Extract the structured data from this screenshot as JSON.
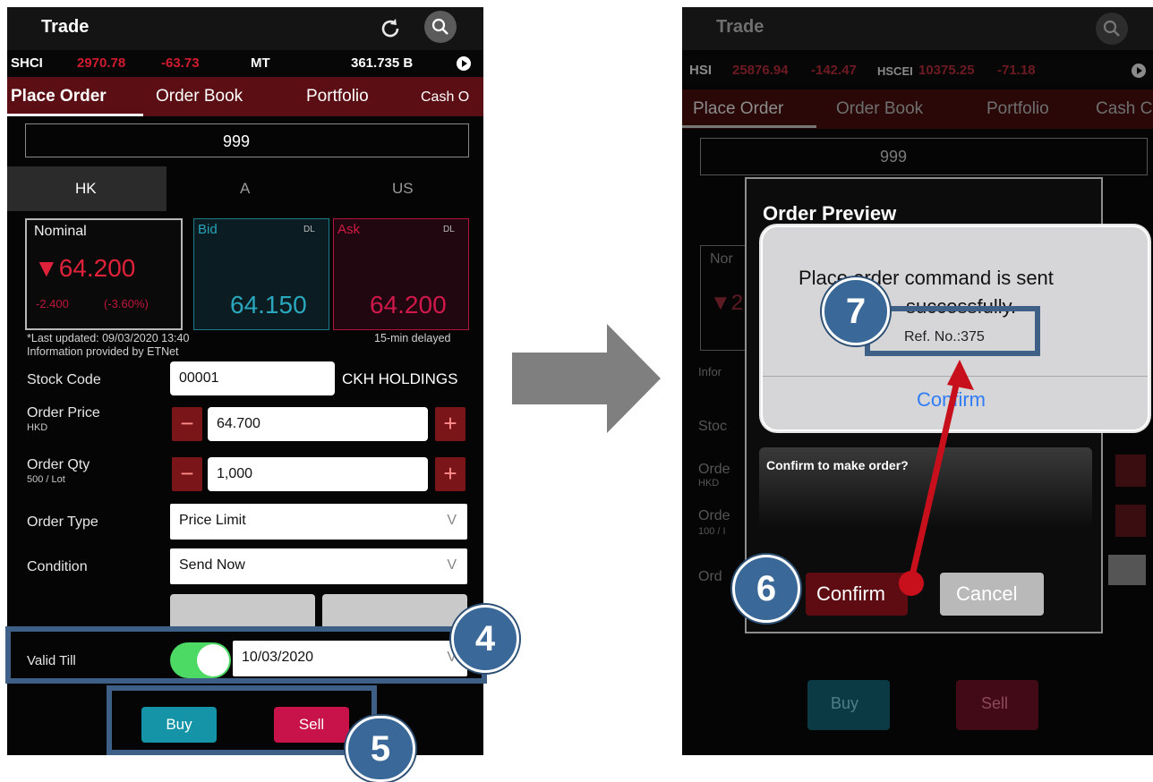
{
  "left": {
    "title": "Trade",
    "ticker": {
      "symbol": "SHCI",
      "price": "2970.78",
      "change": "-63.73",
      "market": "MT",
      "turnover": "361.735 B"
    },
    "tabs": [
      "Place Order",
      "Order Book",
      "Portfolio",
      "Cash O"
    ],
    "search_value": "999",
    "markets": [
      "HK",
      "A",
      "US"
    ],
    "quote": {
      "nominal_label": "Nominal",
      "nominal_value": "▼64.200",
      "nominal_change": "-2.400",
      "nominal_pct": "(-3.60%)",
      "bid_label": "Bid",
      "bid_tag": "DL",
      "bid_value": "64.150",
      "ask_label": "Ask",
      "ask_tag": "DL",
      "ask_value": "64.200"
    },
    "last_updated": "*Last updated: 09/03/2020 13:40",
    "provider": "Information provided by ETNet",
    "delay": "15-min delayed",
    "form": {
      "stock_code_label": "Stock Code",
      "stock_code_value": "00001",
      "stock_name": "CKH HOLDINGS",
      "order_price_label": "Order Price",
      "order_price_unit": "HKD",
      "order_price_value": "64.700",
      "order_qty_label": "Order Qty",
      "order_qty_unit": "500 / Lot",
      "order_qty_value": "1,000",
      "order_type_label": "Order Type",
      "order_type_value": "Price Limit",
      "condition_label": "Condition",
      "condition_value": "Send Now",
      "valid_till_label": "Valid Till",
      "valid_till_value": "10/03/2020",
      "dropdown_glyph": "V",
      "minus": "−",
      "plus": "+"
    },
    "buy_label": "Buy",
    "sell_label": "Sell"
  },
  "right": {
    "title": "Trade",
    "ticker": {
      "symbol": "HSI",
      "price": "25876.94",
      "change": "-142.47",
      "index2": "HSCEI",
      "price2": "10375.25",
      "change2": "-71.18"
    },
    "tabs": [
      "Place Order",
      "Order Book",
      "Portfolio",
      "Cash C"
    ],
    "search_value": "999",
    "preview_title": "Order Preview",
    "alert_message_1": "Place order command is sent",
    "alert_message_2": "successfully.",
    "ref_no": "Ref. No.:375",
    "alert_confirm": "Confirm",
    "confirm_question": "Confirm to make order?",
    "preview_confirm": "Confirm",
    "preview_cancel": "Cancel",
    "buy_label": "Buy",
    "sell_label": "Sell",
    "bg_fragments": {
      "nominal": "Nor",
      "stock": "Stoc",
      "order": "Orde",
      "hkd": "HKD",
      "order2": "Orde",
      "lot": "100 / I",
      "ord": "Ord",
      "info": "Infor",
      "mark": "▼2"
    }
  },
  "annotations": {
    "step4": "4",
    "step5": "5",
    "step6": "6",
    "step7": "7"
  },
  "colors": {
    "accent_red": "#c0163d",
    "buy_teal": "#1594a8",
    "annotation_blue": "#3a6898",
    "arrow_red": "#c8101c",
    "toggle_green": "#4cd964"
  }
}
